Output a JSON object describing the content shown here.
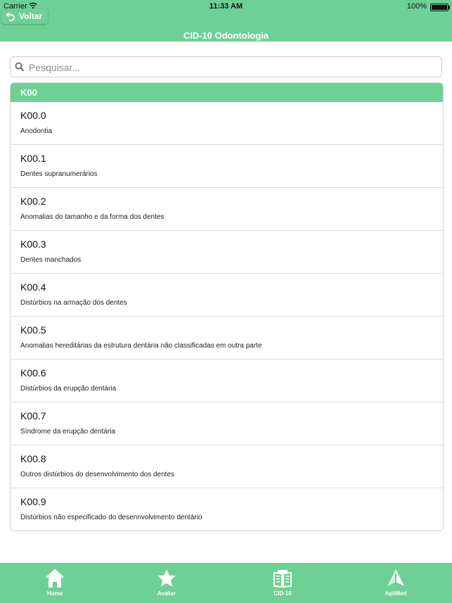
{
  "status_bar": {
    "carrier": "Carrier",
    "time": "11:33 AM",
    "battery": "100%"
  },
  "nav": {
    "back_label": "Voltar",
    "title": "CID-10 Odontologia"
  },
  "search": {
    "placeholder": "Pesquisar..."
  },
  "section": {
    "header": "K00",
    "rows": [
      {
        "code": "K00.0",
        "description": "Anodontia"
      },
      {
        "code": "K00.1",
        "description": "Dentes supranumerários"
      },
      {
        "code": "K00.2",
        "description": "Anomalias do tamanho e da forma dos dentes"
      },
      {
        "code": "K00.3",
        "description": "Dentes manchados"
      },
      {
        "code": "K00.4",
        "description": "Distúrbios na armação dos dentes"
      },
      {
        "code": "K00.5",
        "description": "Anomalias hereditárias da estrutura dentária não classificadas em outra parte"
      },
      {
        "code": "K00.6",
        "description": "Distúrbios da erupção dentária"
      },
      {
        "code": "K00.7",
        "description": "Síndrome da erupção dentária"
      },
      {
        "code": "K00.8",
        "description": "Outros distúrbios do desenvolvimento dos dentes"
      },
      {
        "code": "K00.9",
        "description": "Distúrbios não especificado do desennvolvimento dentário"
      }
    ]
  },
  "tabs": [
    {
      "label": "Home",
      "icon": "home-icon"
    },
    {
      "label": "Avaliar",
      "icon": "star-icon"
    },
    {
      "label": "CID-10",
      "icon": "book-icon"
    },
    {
      "label": "ApliMed",
      "icon": "aplimed-logo-icon"
    }
  ],
  "colors": {
    "accent": "#6dd095",
    "background": "#ffffff"
  }
}
